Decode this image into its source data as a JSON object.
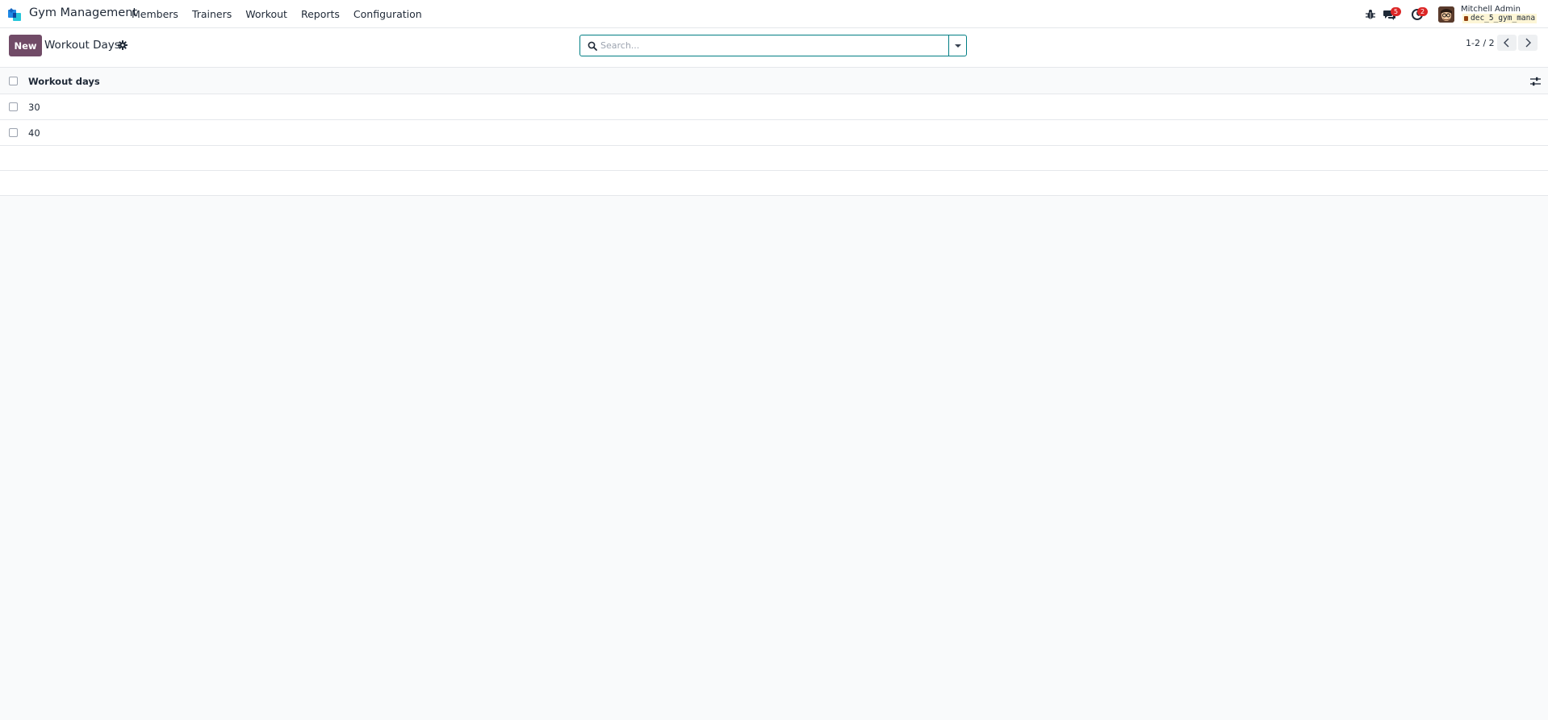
{
  "navbar": {
    "app_name": "Gym Management",
    "menu": [
      "Members",
      "Trainers",
      "Workout",
      "Reports",
      "Configuration"
    ],
    "messages_badge": "5",
    "activities_badge": "2",
    "user_name": "Mitchell Admin",
    "database": "dec_5_gym_mana"
  },
  "control_panel": {
    "new_label": "New",
    "title": "Workout Days",
    "search_placeholder": "Search...",
    "pager": "1-2 / 2"
  },
  "list": {
    "column_header": "Workout days",
    "rows": [
      "30",
      "40"
    ]
  },
  "colors": {
    "primary": "#714b67",
    "accent": "#017e84",
    "badge": "#dc2626"
  }
}
